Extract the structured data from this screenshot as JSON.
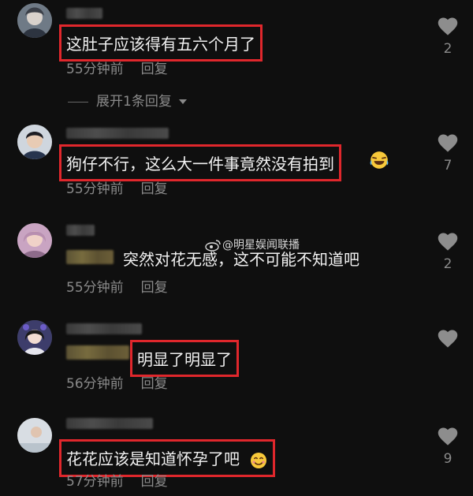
{
  "comments": [
    {
      "text": "这肚子应该得有五六个月了",
      "time": "55分钟前",
      "reply": "回复",
      "likes": "2"
    },
    {
      "text": "狗仔不行，这么大一件事竟然没有拍到",
      "time": "55分钟前",
      "reply": "回复",
      "likes": "7"
    },
    {
      "text": "突然对花无感，这不可能不知道吧",
      "time": "55分钟前",
      "reply": "回复",
      "likes": "2"
    },
    {
      "text": "明显了明显了",
      "time": "56分钟前",
      "reply": "回复",
      "likes": ""
    },
    {
      "text": "花花应该是知道怀孕了吧",
      "time": "57分钟前",
      "reply": "回复",
      "likes": "9"
    }
  ],
  "expand_replies": "展开1条回复",
  "watermark": "@明星娱闻联播",
  "icons": {
    "like": "heart-icon",
    "expand": "caret-down-icon",
    "watermark_logo": "weibo-logo-icon"
  },
  "colors": {
    "highlight_box": "#e0272c",
    "background": "#0f0f0f",
    "meta_text": "#8a8a8a"
  }
}
